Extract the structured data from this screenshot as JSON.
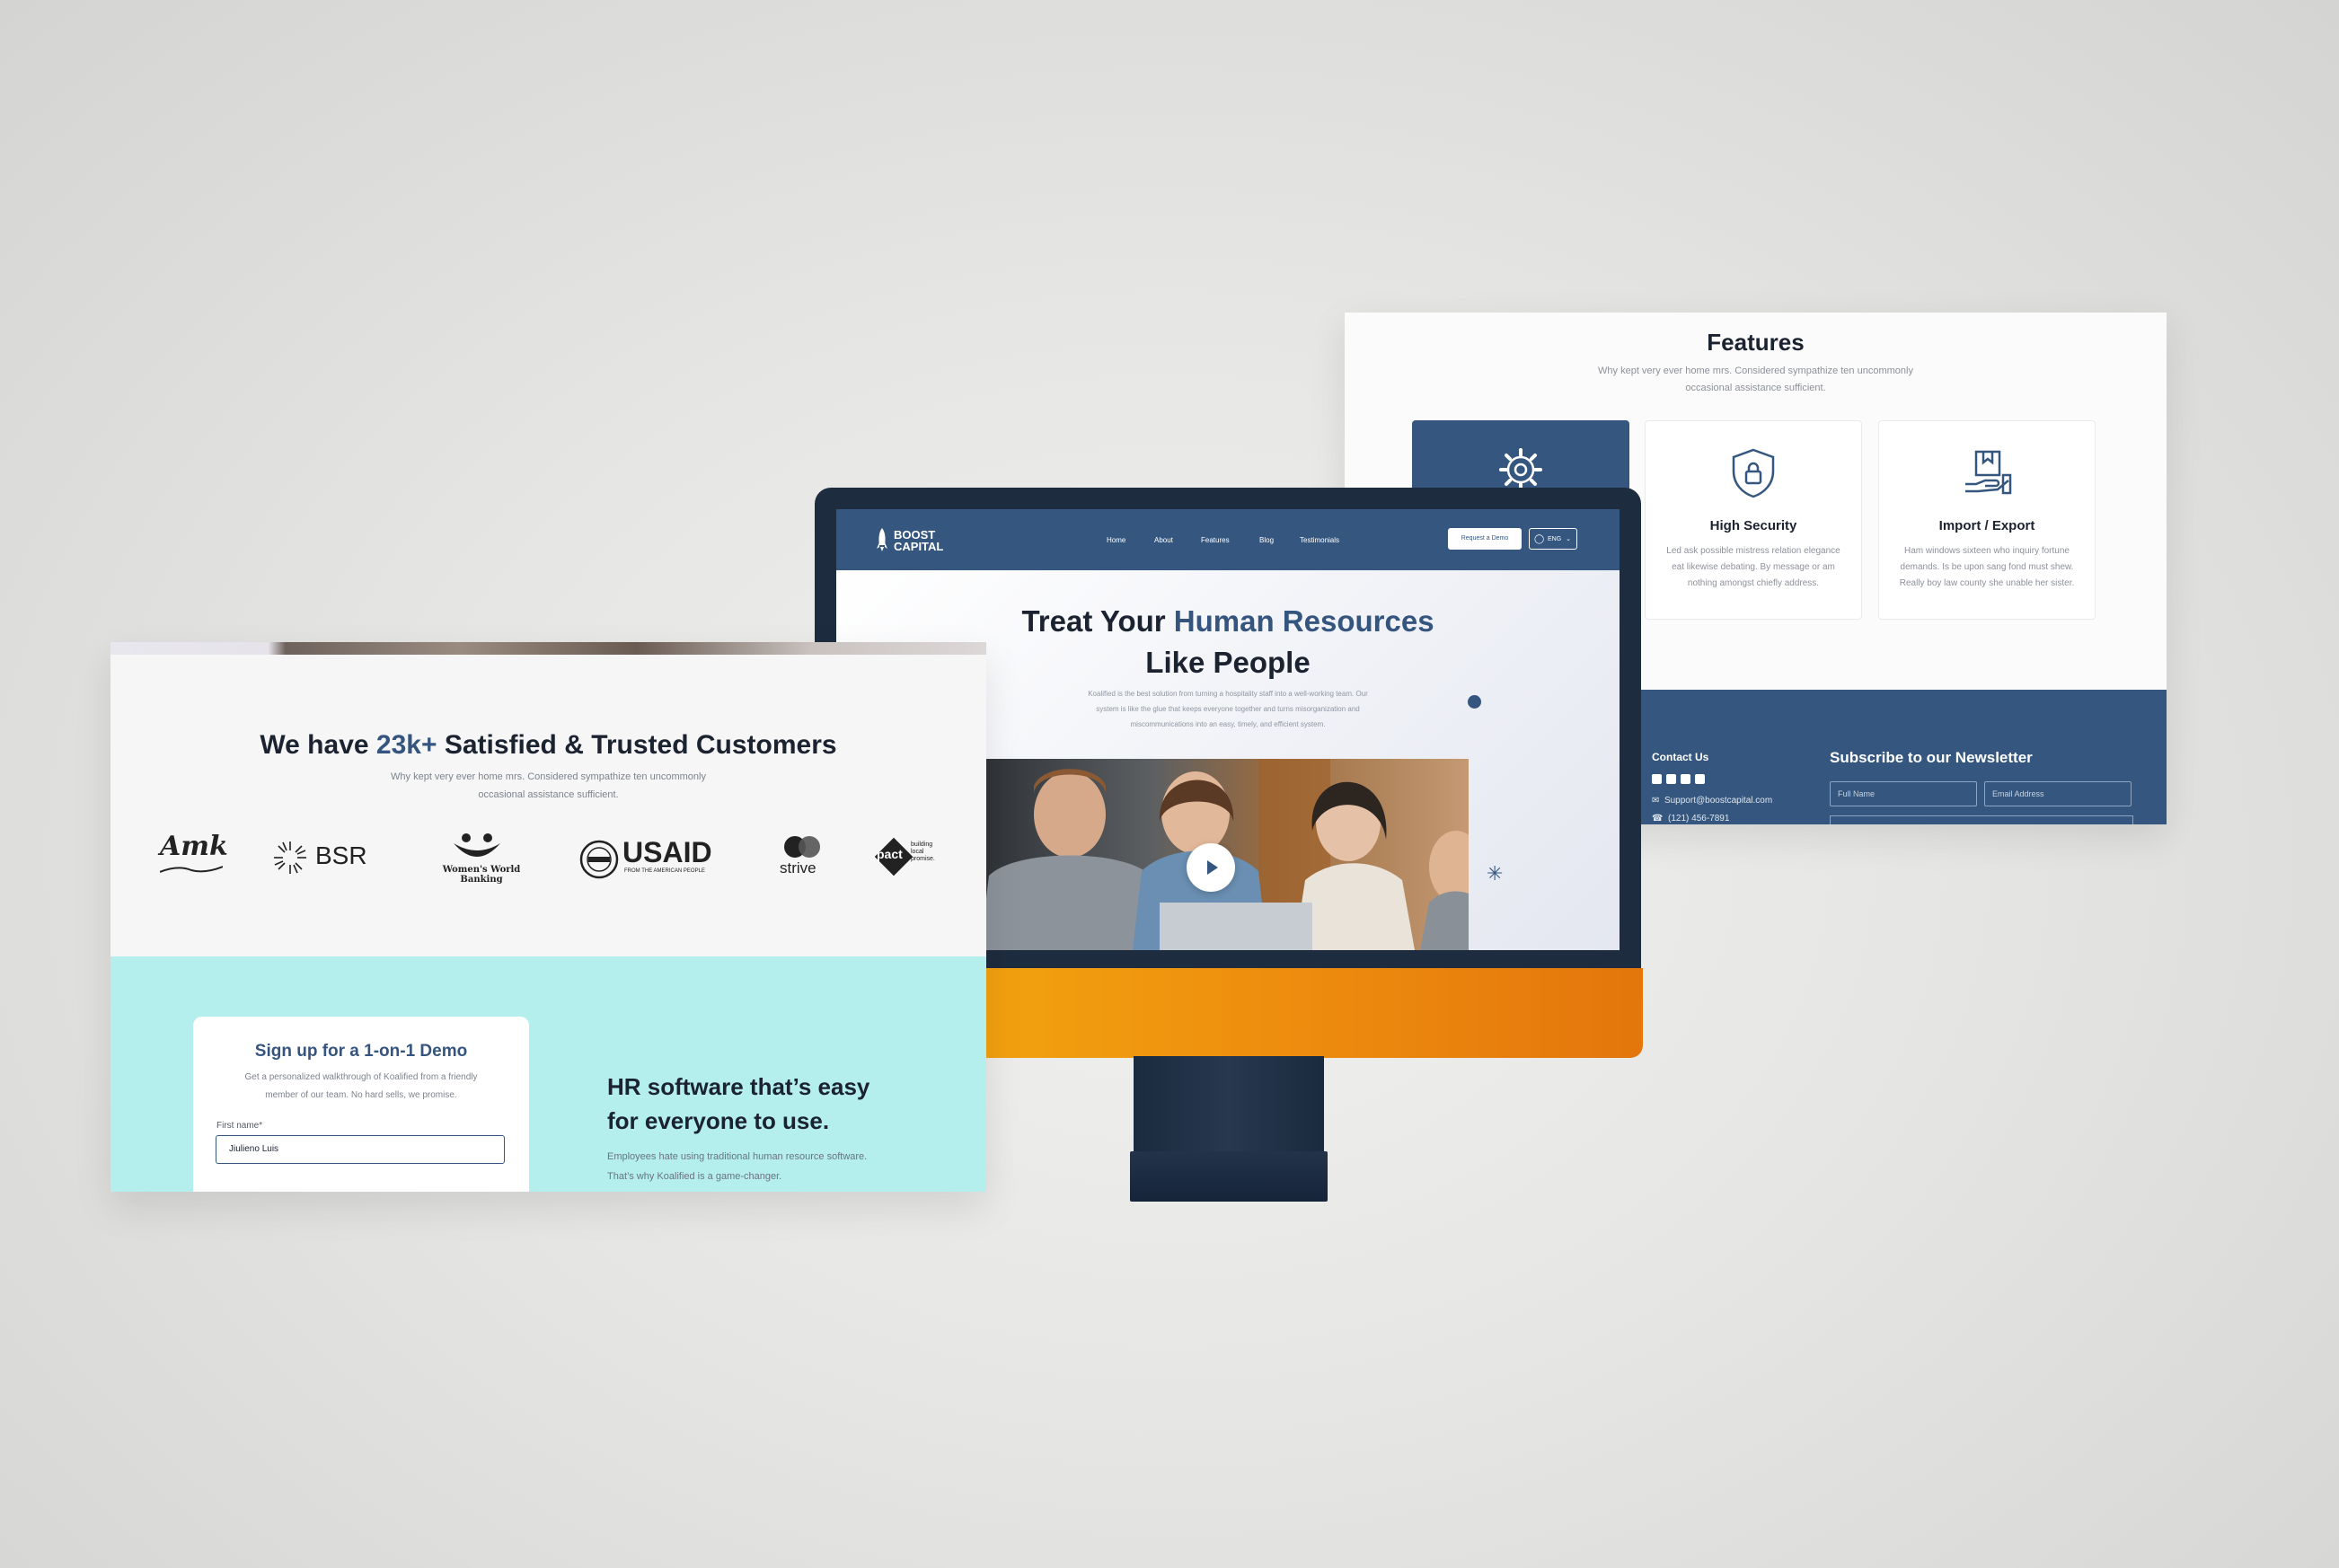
{
  "features": {
    "title": "Features",
    "subtitle_line1": "Why kept very ever home mrs. Considered sympathize ten uncommonly",
    "subtitle_line2": "occasional assistance sufficient.",
    "cards": [
      {
        "title": "",
        "icon": "gear-icon",
        "desc": ""
      },
      {
        "title": "High Security",
        "icon": "shield-lock-icon",
        "desc": "Led ask possible mistress relation elegance eat likewise debating. By message or am nothing amongst chiefly address."
      },
      {
        "title": "Import / Export",
        "icon": "hand-box-icon",
        "desc": "Ham windows sixteen who inquiry fortune demands. Is be upon sang fond must shew. Really boy law county she unable her sister."
      }
    ],
    "footer": {
      "contact_heading": "Contact Us",
      "email": "Support@boostcapital.com",
      "phone": "(121) 456-7891",
      "newsletter_heading": "Subscribe to our Newsletter",
      "full_name_placeholder": "Full Name",
      "email_placeholder": "Email Address"
    }
  },
  "monitor": {
    "logo_line1": "BOOST",
    "logo_line2": "CAPITAL",
    "nav": [
      "Home",
      "About",
      "Features",
      "Blog",
      "Testimonials"
    ],
    "demo_button": "Request a Demo",
    "lang": "ENG",
    "hero_part1": "Treat Your ",
    "hero_highlight": "Human Resources",
    "hero_line2": "Like People",
    "hero_p1": "Koalified is the best solution from turning a hospitality staff into a well-working team. Our",
    "hero_p2": "system is like the glue that keeps everyone together and turns misorganization and",
    "hero_p3": "miscommunications into an easy, timely, and efficient system."
  },
  "customers": {
    "heading_part1": "We have ",
    "heading_highlight": "23k+",
    "heading_part2": " Satisfied & Trusted Customers",
    "sub_line1": "Why kept very ever home mrs. Considered sympathize ten uncommonly",
    "sub_line2": "occasional assistance sufficient.",
    "logos": {
      "amk": "Amk",
      "bsr": "BSR",
      "wwb": "Women's World Banking",
      "usaid": "USAID",
      "usaid_sub": "FROM THE AMERICAN PEOPLE",
      "strive": "strive",
      "pact": "pact",
      "pact_tag1": "building",
      "pact_tag2": "local",
      "pact_tag3": "promise."
    }
  },
  "signup": {
    "title": "Sign up for a 1-on-1 Demo",
    "desc_line1": "Get a personalized walkthrough of Koalified from a friendly",
    "desc_line2": "member of our team. No hard sells, we promise.",
    "first_name_label": "First name*",
    "first_name_value": "Jiulieno Luis"
  },
  "hr": {
    "heading_line1": "HR software that’s easy",
    "heading_line2": "for everyone to use.",
    "p_line1": "Employees hate using traditional human resource software.",
    "p_line2": "That’s why Koalified is a game-changer."
  },
  "colors": {
    "brand_blue": "#35577f",
    "accent_orange": "#ee8e0e",
    "teal": "#b4efed"
  }
}
